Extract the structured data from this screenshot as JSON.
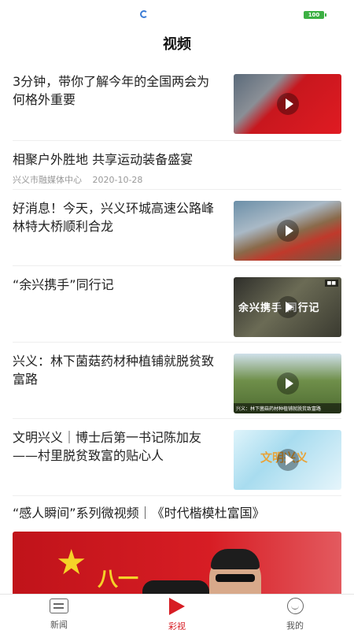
{
  "status_bar": {
    "battery": "100"
  },
  "page": {
    "title": "视频"
  },
  "feed": [
    {
      "title": "3分钟，带你了解今年的全国两会为何格外重要",
      "thumb_icon": "video-thumbnail-red-flag"
    },
    {
      "title": "相聚户外胜地 共享运动装备盛宴",
      "source": "兴义市融媒体中心",
      "date": "2020-10-28"
    },
    {
      "title": "好消息！今天，兴义环城高速公路峰林特大桥顺利合龙",
      "thumb_icon": "video-thumbnail-bridge"
    },
    {
      "title": "“余兴携手”同行记",
      "thumb_icon": "video-thumbnail-text",
      "thumb_caption": "余兴携手 同行记"
    },
    {
      "title": "兴义：林下菌菇药材种植铺就脱贫致富路",
      "thumb_icon": "video-thumbnail-forest",
      "thumb_subtitle": "兴义：林下菌菇药材种植铺就脱贫致富路"
    },
    {
      "title": "文明兴义｜博士后第一书记陈加友——村里脱贫致富的贴心人",
      "thumb_icon": "video-thumbnail-city",
      "thumb_caption": "文明兴义"
    },
    {
      "title": "“感人瞬间”系列微视频｜《时代楷模杜富国》",
      "banner_text": "八一"
    }
  ],
  "tabbar": [
    {
      "label": "新闻",
      "icon": "news-icon",
      "active": false
    },
    {
      "label": "彩视",
      "icon": "play-icon",
      "active": true
    },
    {
      "label": "我的",
      "icon": "profile-icon",
      "active": false
    }
  ],
  "colors": {
    "accent": "#d71d24",
    "divider": "#eeeeee"
  }
}
